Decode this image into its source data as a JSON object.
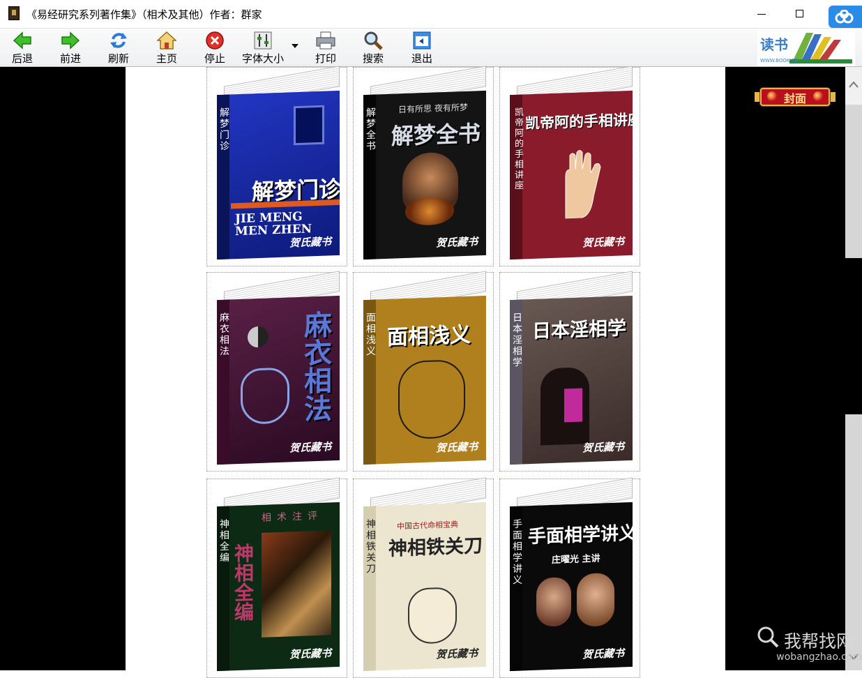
{
  "window": {
    "title": "《易经研究系列著作集》（相术及其他）作者：群家"
  },
  "toolbar": {
    "back": "后退",
    "forward": "前进",
    "refresh": "刷新",
    "home": "主页",
    "stop": "停止",
    "font_size": "字体大小",
    "print": "打印",
    "search": "搜索",
    "exit": "退出"
  },
  "side": {
    "cover_label": "封面"
  },
  "books": [
    {
      "spine": "解梦门诊",
      "title": "解梦门诊",
      "subtitle": "JIE MENG MEN ZHEN",
      "stamp": "贺氏藏书",
      "color": "#1a2fa8"
    },
    {
      "spine": "解梦全书",
      "title": "解梦全书",
      "subtitle": "日有所思 夜有所梦",
      "stamp": "贺氏藏书",
      "color": "#111111"
    },
    {
      "spine": "凯帝阿的手相讲座",
      "title": "凯帝阿的手相讲座",
      "subtitle": "",
      "stamp": "贺氏藏书",
      "color": "#8a1b2a"
    },
    {
      "spine": "麻衣相法",
      "title": "麻衣相法",
      "subtitle": "",
      "stamp": "贺氏藏书",
      "color": "#4a1838"
    },
    {
      "spine": "面相浅义",
      "title": "面相浅义",
      "subtitle": "",
      "stamp": "贺氏藏书",
      "color": "#a8781c"
    },
    {
      "spine": "日本淫相学",
      "title": "日本淫相学",
      "subtitle": "",
      "stamp": "贺氏藏书",
      "color": "#4d4d55"
    },
    {
      "spine": "神相全编",
      "title": "神相全编",
      "subtitle": "相术注评",
      "stamp": "贺氏藏书",
      "color": "#0d2a14"
    },
    {
      "spine": "神相铁关刀",
      "title": "神相铁关刀",
      "subtitle": "中国古代命相宝典",
      "stamp": "贺氏藏书",
      "color": "#e8e2cc"
    },
    {
      "spine": "手面相学讲义",
      "title": "手面相学讲义",
      "subtitle": "庄曜光 主讲",
      "stamp": "贺氏藏书",
      "color": "#0a0a0a"
    }
  ],
  "watermark": {
    "text": "我帮找网",
    "url": "wobangzhao.com"
  }
}
